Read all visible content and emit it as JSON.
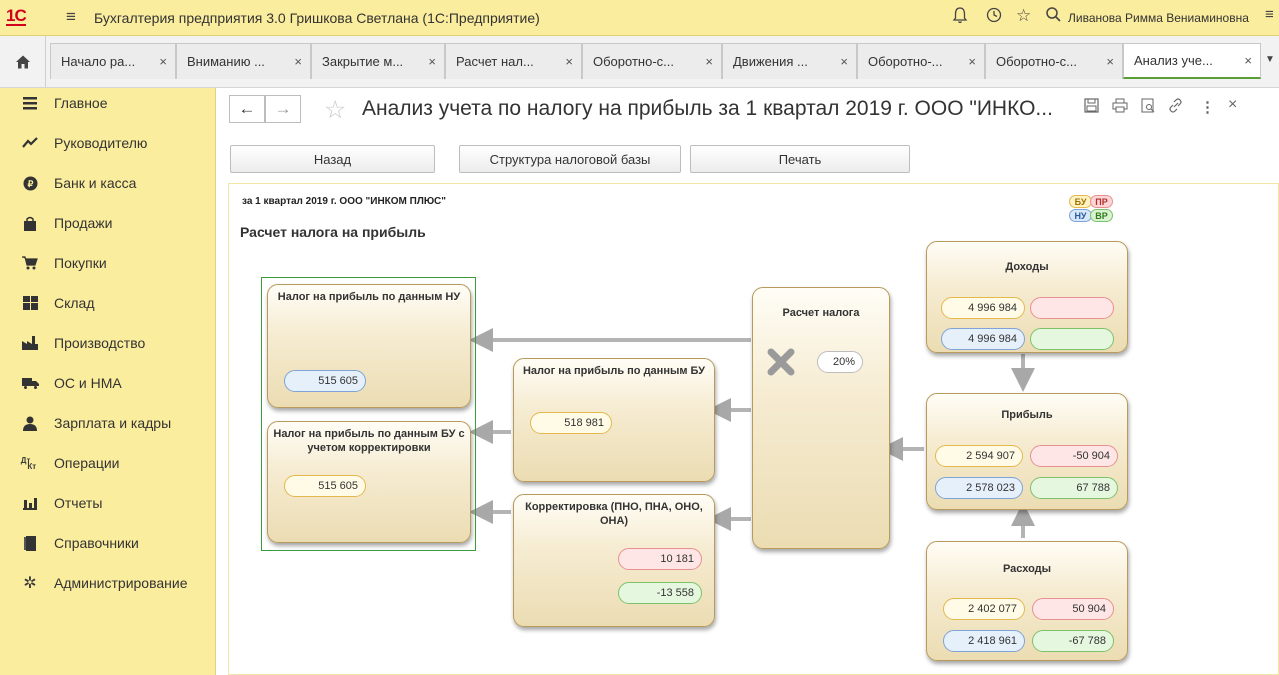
{
  "titlebar": {
    "logo": "1С",
    "app_title": "Бухгалтерия предприятия 3.0 Гришкова Светлана  (1С:Предприятие)",
    "user_name": "Ливанова Римма Вениаминовна"
  },
  "tabs": [
    {
      "label": "Начало ра..."
    },
    {
      "label": "Вниманию ..."
    },
    {
      "label": "Закрытие м..."
    },
    {
      "label": "Расчет нал..."
    },
    {
      "label": "Оборотно-с..."
    },
    {
      "label": "Движения ..."
    },
    {
      "label": "Оборотно-..."
    },
    {
      "label": "Оборотно-с..."
    },
    {
      "label": "Анализ уче..."
    }
  ],
  "sidebar": {
    "items": [
      {
        "label": "Главное",
        "icon": "menu-lines-icon"
      },
      {
        "label": "Руководителю",
        "icon": "trend-chart-icon"
      },
      {
        "label": "Банк и касса",
        "icon": "bank-icon"
      },
      {
        "label": "Продажи",
        "icon": "shopping-bag-icon"
      },
      {
        "label": "Покупки",
        "icon": "cart-icon"
      },
      {
        "label": "Склад",
        "icon": "warehouse-icon"
      },
      {
        "label": "Производство",
        "icon": "factory-icon"
      },
      {
        "label": "ОС и НМА",
        "icon": "truck-icon"
      },
      {
        "label": "Зарплата и кадры",
        "icon": "person-icon"
      },
      {
        "label": "Операции",
        "icon": "debit-credit-icon"
      },
      {
        "label": "Отчеты",
        "icon": "bar-chart-icon"
      },
      {
        "label": "Справочники",
        "icon": "book-icon"
      },
      {
        "label": "Администрирование",
        "icon": "gear-icon"
      }
    ]
  },
  "header": {
    "title": "Анализ учета по налогу на прибыль за 1 квартал 2019 г. ООО \"ИНКО...",
    "buttons": {
      "back": "Назад",
      "structure": "Структура налоговой базы",
      "print": "Печать"
    }
  },
  "report": {
    "head": "за 1 квартал 2019 г. ООО \"ИНКОМ ПЛЮС\"",
    "title": "Расчет налога на прибыль",
    "legend": {
      "bu": "БУ",
      "pr": "ПР",
      "nu": "НУ",
      "vr": "ВР"
    },
    "colors": {
      "bu": "#e4b84c",
      "pr": "#e89090",
      "nu": "#7fa3d6",
      "vr": "#7cc26a",
      "frame": "#3a9c3a"
    },
    "nodes": {
      "tax_nu": {
        "title": "Налог на прибыль по данным НУ",
        "nu": "515 605"
      },
      "tax_bu_adj": {
        "title": "Налог на прибыль по данным БУ с учетом корректировки",
        "bu": "515 605"
      },
      "tax_bu": {
        "title": "Налог на прибыль по данным БУ",
        "bu": "518 981"
      },
      "correction": {
        "title": "Корректировка (ПНО, ПНА, ОНО, ОНА)",
        "pr": "10 181",
        "vr": "-13 558"
      },
      "calc": {
        "title": "Расчет налога",
        "rate": "20%"
      },
      "income": {
        "title": "Доходы",
        "bu": "4 996 984",
        "pr": "",
        "nu": "4 996 984",
        "vr": ""
      },
      "profit": {
        "title": "Прибыль",
        "bu": "2 594 907",
        "pr": "-50 904",
        "nu": "2 578 023",
        "vr": "67 788"
      },
      "expenses": {
        "title": "Расходы",
        "bu": "2 402 077",
        "pr": "50 904",
        "nu": "2 418 961",
        "vr": "-67 788"
      }
    }
  }
}
